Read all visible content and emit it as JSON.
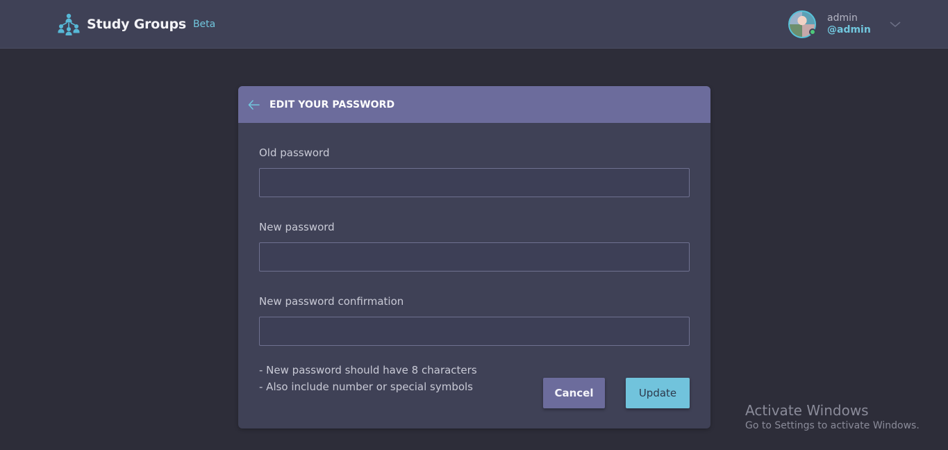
{
  "header": {
    "brand_name": "Study Groups",
    "brand_tag": "Beta",
    "logo_icon": "people-network-icon",
    "user": {
      "name": "admin",
      "handle": "@admin",
      "status": "online"
    }
  },
  "form": {
    "title": "EDIT YOUR PASSWORD",
    "fields": [
      {
        "label": "Old password",
        "value": "",
        "placeholder": ""
      },
      {
        "label": "New password",
        "value": "",
        "placeholder": ""
      },
      {
        "label": "New password confirmation",
        "value": "",
        "placeholder": ""
      }
    ],
    "hints": [
      "- New password should have 8 characters",
      "- Also include number or special symbols"
    ],
    "cancel_label": "Cancel",
    "update_label": "Update"
  },
  "watermark": {
    "line1": "Activate Windows",
    "line2": "Go to Settings to activate Windows."
  },
  "colors": {
    "accent": "#71c6dd",
    "header_bg": "#3f4156",
    "page_bg": "#2d2d39",
    "card_header": "#6c6c9c",
    "online": "#4ec87a"
  }
}
